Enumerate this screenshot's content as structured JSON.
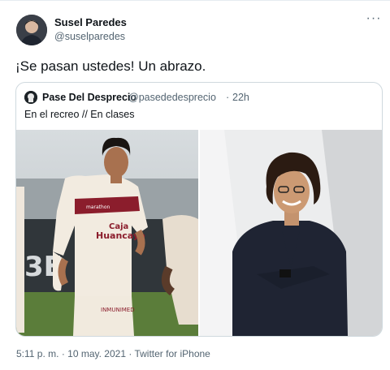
{
  "tweet": {
    "author_name": "Susel Paredes",
    "author_handle": "@suselparedes",
    "more_glyph": "···",
    "text": "¡Se pasan ustedes! Un abrazo.",
    "quote": {
      "author_name": "Pase Del Desprecio",
      "author_handle": "@pasededesprecio",
      "separator": "·",
      "time": "22h",
      "text": "En el recreo // En clases",
      "photo_left_jersey_sponsor": "Caja",
      "photo_left_jersey_city": "Huancayo",
      "photo_left_brand": "marathon",
      "photo_left_shorts_text": "INMUNIMED"
    },
    "time": "5:11 p. m.",
    "separator": "·",
    "date": "10 may. 2021",
    "source": "Twitter for iPhone"
  },
  "colors": {
    "text_primary": "#0f1419",
    "text_secondary": "#536471",
    "border": "#cfd9de",
    "jersey_red": "#8b1d2c"
  },
  "icons": [
    "more-options-icon"
  ]
}
